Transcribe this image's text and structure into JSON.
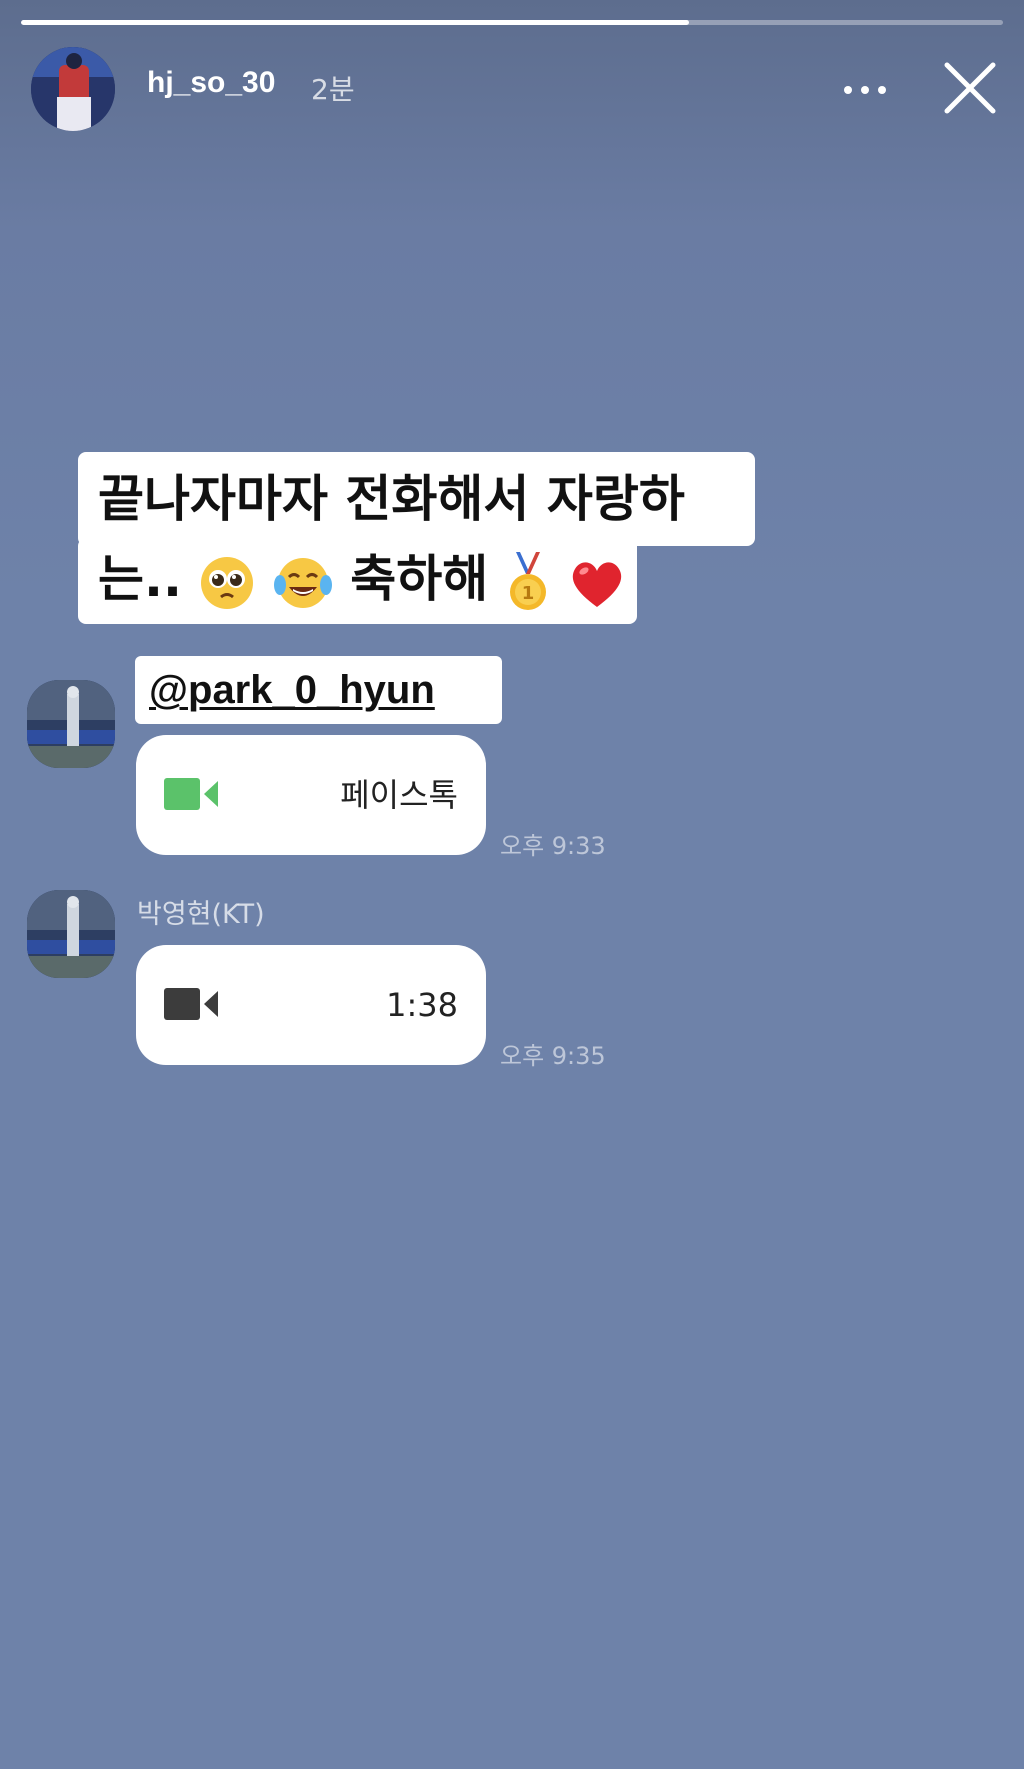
{
  "progress": {
    "fraction": 0.68
  },
  "header": {
    "username": "hj_so_30",
    "time_ago": "2분",
    "more_icon": "more-horizontal-icon",
    "close_icon": "close-icon"
  },
  "caption": {
    "line1": "끝나자마자 전화해서 자랑하",
    "line2_text": "는..",
    "line2_text_b": "축하해",
    "emojis": [
      "pleading-face",
      "tears-of-joy",
      "first-place-medal",
      "red-heart"
    ]
  },
  "mention": {
    "handle": "@park_0_hyun"
  },
  "messages": [
    {
      "label": "페이스톡",
      "time": "오후 9:33",
      "icon": "video-camera-icon",
      "icon_color": "#5bc26a"
    },
    {
      "sender": "박영현(KT)",
      "label": "1:38",
      "time": "오후 9:35",
      "icon": "video-camera-icon",
      "icon_color": "#3c3c3c"
    }
  ],
  "colors": {
    "background": "#6e82a9",
    "bubble": "#ffffff"
  }
}
